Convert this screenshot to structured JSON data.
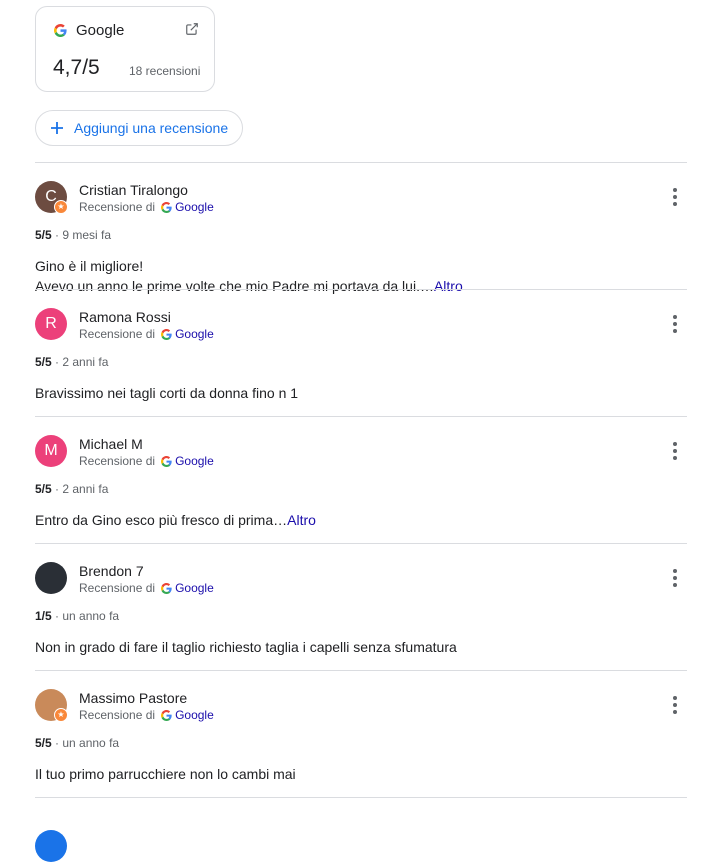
{
  "summary": {
    "brand": "Google",
    "rating": "4,7/5",
    "count": "18 recensioni"
  },
  "add_review": {
    "label": "Aggiungi una recensione"
  },
  "reviews": [
    {
      "initial": "C",
      "avatar_color": "#6d4c41",
      "has_badge": true,
      "name": "Cristian Tiralongo",
      "source_prefix": "Recensione di",
      "source_name": "Google",
      "score": "5/5",
      "time": " · 9 mesi fa",
      "lines": [
        "Gino è il migliore!",
        "Avevo un anno le prime volte che mio Padre mi portava da lui.…"
      ],
      "more": "Altro"
    },
    {
      "initial": "R",
      "avatar_color": "#ec407a",
      "has_badge": false,
      "name": "Ramona Rossi",
      "source_prefix": "Recensione di",
      "source_name": "Google",
      "score": "5/5",
      "time": " · 2 anni fa",
      "lines": [
        "Bravissimo nei tagli corti da donna fino n 1"
      ],
      "more": ""
    },
    {
      "initial": "M",
      "avatar_color": "#ec407a",
      "has_badge": false,
      "name": "Michael M",
      "source_prefix": "Recensione di",
      "source_name": "Google",
      "score": "5/5",
      "time": " · 2 anni fa",
      "lines": [
        "Entro da Gino esco più fresco di prima…"
      ],
      "more": "Altro"
    },
    {
      "initial": "",
      "avatar_color": "#2a2f36",
      "has_badge": false,
      "name": "Brendon 7",
      "source_prefix": "Recensione di",
      "source_name": "Google",
      "score": "1/5",
      "time": " · un anno fa",
      "lines": [
        "Non in grado di fare il taglio richiesto taglia i capelli senza sfumatura"
      ],
      "more": ""
    },
    {
      "initial": "",
      "avatar_color": "#c98a5a",
      "has_badge": true,
      "name": "Massimo Pastore",
      "source_prefix": "Recensione di",
      "source_name": "Google",
      "score": "5/5",
      "time": " · un anno fa",
      "lines": [
        "Il tuo primo parrucchiere non lo cambi mai"
      ],
      "more": ""
    }
  ]
}
